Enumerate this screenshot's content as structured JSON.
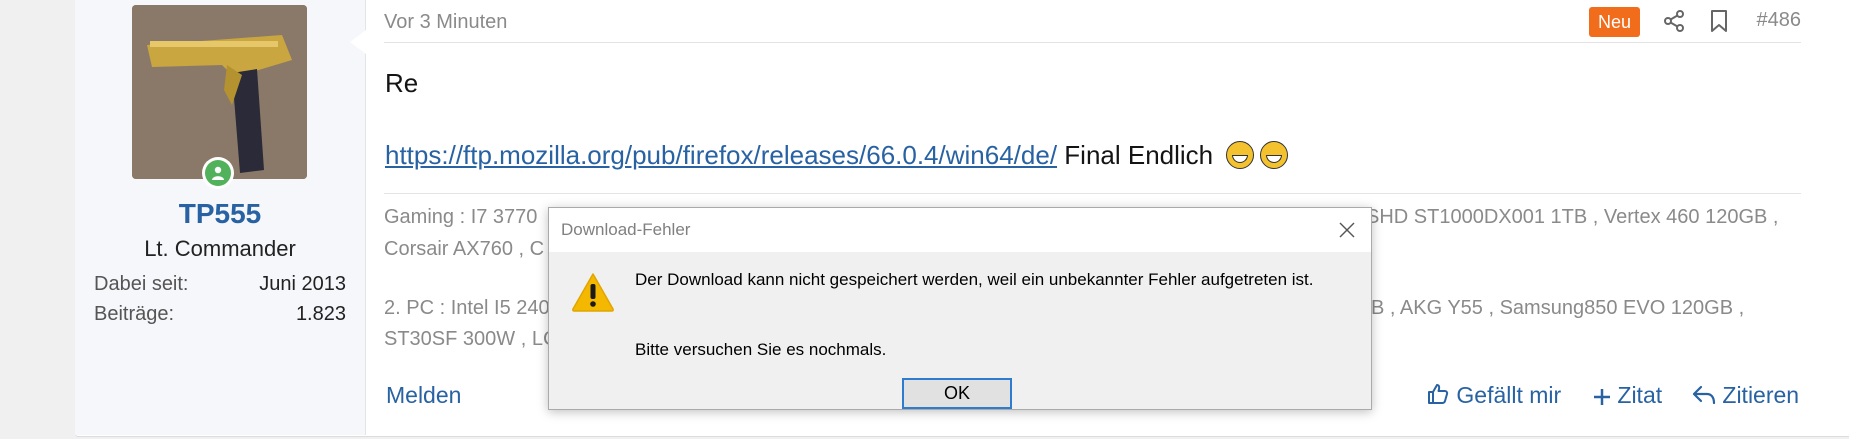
{
  "user": {
    "name": "TP555",
    "title": "Lt. Commander",
    "stats": [
      {
        "label": "Dabei seit:",
        "value": "Juni 2013"
      },
      {
        "label": "Beiträge:",
        "value": "1.823"
      }
    ]
  },
  "post": {
    "time": "Vor 3 Minuten",
    "badge": "Neu",
    "number": "#486",
    "line1": "Re",
    "link": "https://ftp.mozilla.org/pub/firefox/releases/66.0.4/win64/de/",
    "after_link": "Final Endlich",
    "signature": [
      "Gaming : I7 3770",
      "SHD ST1000DX001 1TB , Vertex 460 120GB ,",
      "Corsair AX760 , C",
      "2. PC : Intel I5 240",
      "B , AKG Y55 , Samsung850 EVO 120GB ,",
      "ST30SF 300W , LC"
    ]
  },
  "footer": {
    "report": "Melden",
    "like": "Gefällt mir",
    "quote_plus": "Zitat",
    "reply": "Zitieren"
  },
  "dialog": {
    "title": "Download-Fehler",
    "message": "Der Download kann nicht gespeichert werden, weil ein unbekannter Fehler aufgetreten ist.",
    "message2": "Bitte versuchen Sie es nochmals.",
    "ok": "OK"
  },
  "colors": {
    "link": "#2862a3",
    "badge_new": "#f26d1b",
    "online": "#52b15b",
    "warning": "#f5b800"
  },
  "icons": [
    "share-icon",
    "bookmark-icon",
    "thumbs-up-icon",
    "plus-icon",
    "reply-icon",
    "warning-icon",
    "close-icon",
    "user-online-icon"
  ]
}
